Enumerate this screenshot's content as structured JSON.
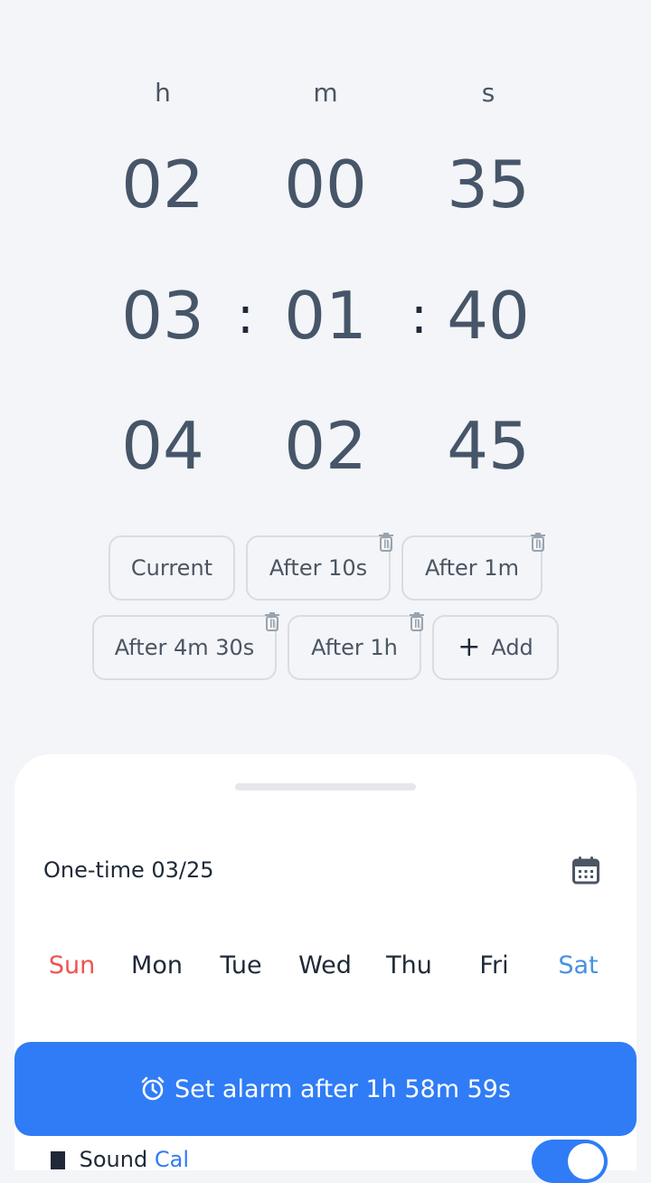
{
  "units": {
    "hours": "h",
    "minutes": "m",
    "seconds": "s"
  },
  "picker": {
    "hours": [
      "02",
      "03",
      "04"
    ],
    "minutes": [
      "00",
      "01",
      "02"
    ],
    "seconds": [
      "35",
      "40",
      "45"
    ],
    "separator": ":"
  },
  "presets": [
    {
      "label": "Current"
    },
    {
      "label": "After 10s"
    },
    {
      "label": "After 1m"
    },
    {
      "label": "After 4m 30s"
    },
    {
      "label": "After 1h"
    },
    {
      "label": "Add"
    }
  ],
  "schedule": {
    "label": "One-time 03/25"
  },
  "days": [
    "Sun",
    "Mon",
    "Tue",
    "Wed",
    "Thu",
    "Fri",
    "Sat"
  ],
  "day_colors": {
    "sun": "#ef5350",
    "sat": "#4a90e2",
    "default": "#1f2937"
  },
  "cta": {
    "label": "Set alarm after 1h 58m 59s"
  },
  "sound_row": {
    "label_a": "Sound",
    "label_b": "Cal"
  },
  "accent": "#2f7cf6"
}
